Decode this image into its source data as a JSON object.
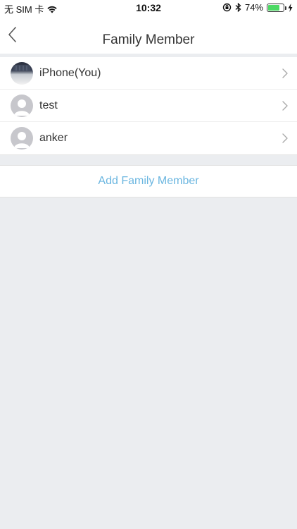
{
  "status_bar": {
    "carrier": "无 SIM 卡",
    "time": "10:32",
    "battery_percent": "74%",
    "battery_level": 0.74,
    "battery_color": "#4cd964"
  },
  "nav": {
    "title": "Family Member",
    "back_icon": "chevron-left-icon"
  },
  "members": [
    {
      "name": "iPhone(You)",
      "avatar": "photo"
    },
    {
      "name": "test",
      "avatar": "default-person-icon"
    },
    {
      "name": "anker",
      "avatar": "default-person-icon"
    }
  ],
  "add_button": {
    "label": "Add Family Member",
    "color": "#6bb6e0"
  }
}
